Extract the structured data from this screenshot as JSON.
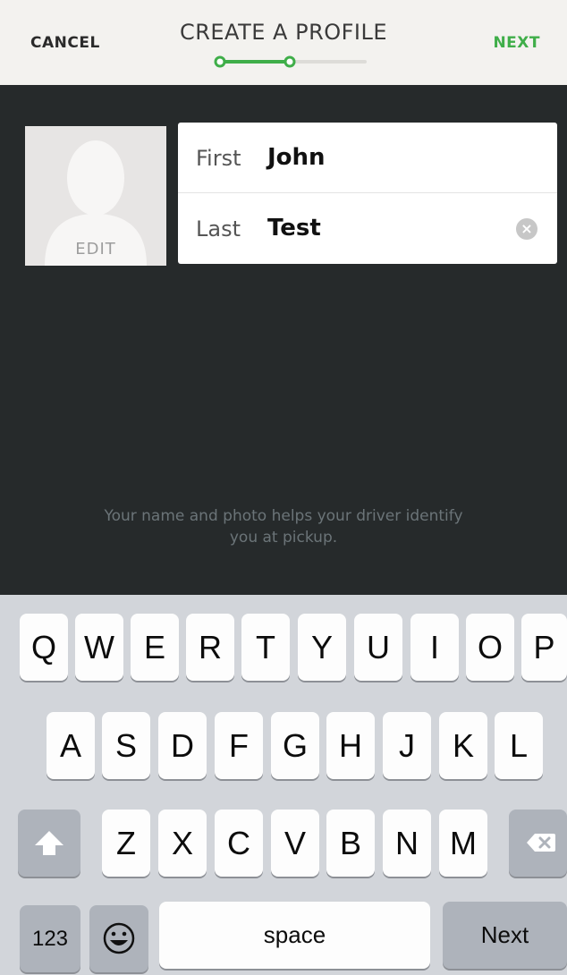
{
  "header": {
    "cancel_label": "CANCEL",
    "title": "CREATE A PROFILE",
    "next_label": "NEXT",
    "progress_step": 2,
    "progress_total": 3
  },
  "profile": {
    "photo_edit_label": "EDIT",
    "first": {
      "label": "First",
      "value": "John"
    },
    "last": {
      "label": "Last",
      "value": "Test",
      "clear_icon": "clear-icon"
    },
    "helper_text_line1": "Your name and photo helps your driver identify",
    "helper_text_line2": "you at pickup."
  },
  "keyboard": {
    "row1": [
      "Q",
      "W",
      "E",
      "R",
      "T",
      "Y",
      "U",
      "I",
      "O",
      "P"
    ],
    "row2": [
      "A",
      "S",
      "D",
      "F",
      "G",
      "H",
      "J",
      "K",
      "L"
    ],
    "row3": [
      "Z",
      "X",
      "C",
      "V",
      "B",
      "N",
      "M"
    ],
    "numbers_label": "123",
    "space_label": "space",
    "return_label": "Next",
    "shift_icon": "shift-icon",
    "delete_icon": "backspace-icon",
    "emoji_icon": "emoji-icon"
  },
  "colors": {
    "accent": "#3fae49",
    "header_bg": "#f3f2ef",
    "dark_bg": "#262a2b",
    "keyboard_bg": "#d2d5da"
  }
}
